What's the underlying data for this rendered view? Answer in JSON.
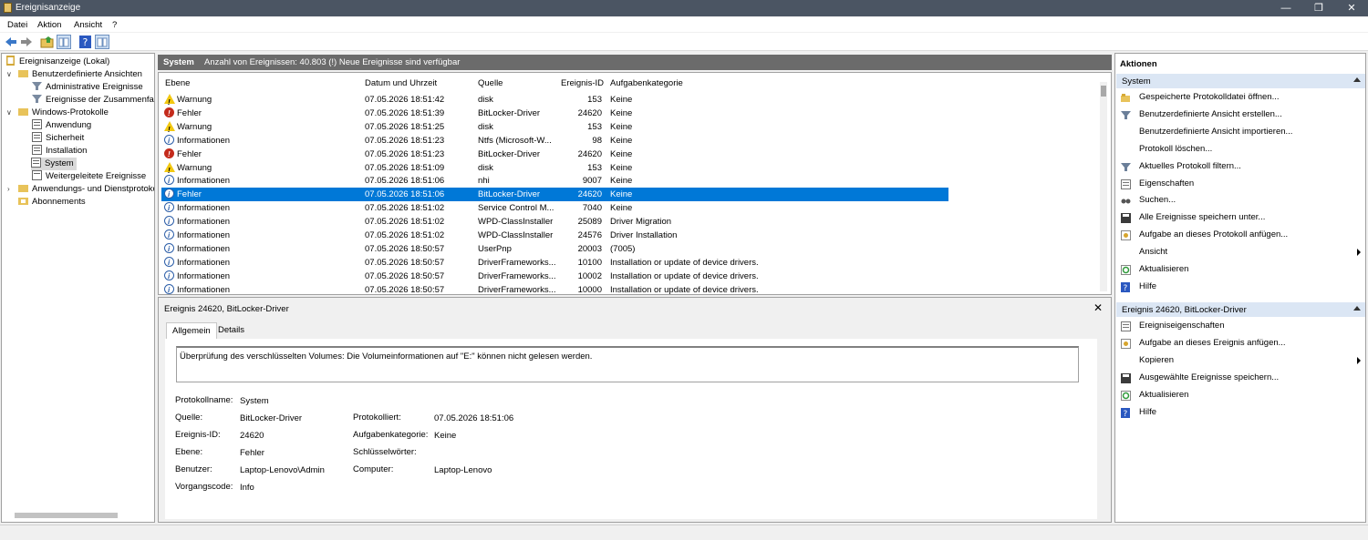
{
  "window": {
    "title": "Ereignisanzeige"
  },
  "menu": [
    "Datei",
    "Aktion",
    "Ansicht",
    "?"
  ],
  "tree": {
    "root": "Ereignisanzeige (Lokal)",
    "custom_views": "Benutzerdefinierte Ansichten",
    "admin_events": "Administrative Ereignisse",
    "summary_events": "Ereignisse der Zusammenfass",
    "windows_logs": "Windows-Protokolle",
    "application": "Anwendung",
    "security": "Sicherheit",
    "installation": "Installation",
    "system": "System",
    "forwarded": "Weitergeleitete Ereignisse",
    "app_service_logs": "Anwendungs- und Dienstprotoko",
    "subscriptions": "Abonnements"
  },
  "log_header": {
    "name": "System",
    "count": "Anzahl von Ereignissen: 40.803 (!) Neue Ereignisse sind verfügbar"
  },
  "columns": {
    "level": "Ebene",
    "datetime": "Datum und Uhrzeit",
    "source": "Quelle",
    "event_id": "Ereignis-ID",
    "category": "Aufgabenkategorie"
  },
  "events": [
    {
      "icon": "warn",
      "level": "Warnung",
      "datetime": "07.05.2026 18:51:42",
      "source": "disk",
      "id": "153",
      "category": "Keine"
    },
    {
      "icon": "err",
      "level": "Fehler",
      "datetime": "07.05.2026 18:51:39",
      "source": "BitLocker-Driver",
      "id": "24620",
      "category": "Keine"
    },
    {
      "icon": "warn",
      "level": "Warnung",
      "datetime": "07.05.2026 18:51:25",
      "source": "disk",
      "id": "153",
      "category": "Keine"
    },
    {
      "icon": "info",
      "level": "Informationen",
      "datetime": "07.05.2026 18:51:23",
      "source": "Ntfs (Microsoft-W...",
      "id": "98",
      "category": "Keine"
    },
    {
      "icon": "err",
      "level": "Fehler",
      "datetime": "07.05.2026 18:51:23",
      "source": "BitLocker-Driver",
      "id": "24620",
      "category": "Keine"
    },
    {
      "icon": "warn",
      "level": "Warnung",
      "datetime": "07.05.2026 18:51:09",
      "source": "disk",
      "id": "153",
      "category": "Keine"
    },
    {
      "icon": "info",
      "level": "Informationen",
      "datetime": "07.05.2026 18:51:06",
      "source": "nhi",
      "id": "9007",
      "category": "Keine"
    },
    {
      "icon": "info",
      "level": "Fehler",
      "datetime": "07.05.2026 18:51:06",
      "source": "BitLocker-Driver",
      "id": "24620",
      "category": "Keine",
      "selected": true
    },
    {
      "icon": "info",
      "level": "Informationen",
      "datetime": "07.05.2026 18:51:02",
      "source": "Service Control M...",
      "id": "7040",
      "category": "Keine"
    },
    {
      "icon": "info",
      "level": "Informationen",
      "datetime": "07.05.2026 18:51:02",
      "source": "WPD-ClassInstaller",
      "id": "25089",
      "category": "Driver Migration"
    },
    {
      "icon": "info",
      "level": "Informationen",
      "datetime": "07.05.2026 18:51:02",
      "source": "WPD-ClassInstaller",
      "id": "24576",
      "category": "Driver Installation"
    },
    {
      "icon": "info",
      "level": "Informationen",
      "datetime": "07.05.2026 18:50:57",
      "source": "UserPnp",
      "id": "20003",
      "category": "(7005)"
    },
    {
      "icon": "info",
      "level": "Informationen",
      "datetime": "07.05.2026 18:50:57",
      "source": "DriverFrameworks...",
      "id": "10100",
      "category": "Installation or update of device drivers."
    },
    {
      "icon": "info",
      "level": "Informationen",
      "datetime": "07.05.2026 18:50:57",
      "source": "DriverFrameworks...",
      "id": "10002",
      "category": "Installation or update of device drivers."
    },
    {
      "icon": "info",
      "level": "Informationen",
      "datetime": "07.05.2026 18:50:57",
      "source": "DriverFrameworks...",
      "id": "10000",
      "category": "Installation or update of device drivers."
    }
  ],
  "detail": {
    "title": "Ereignis 24620, BitLocker-Driver",
    "tab_general": "Allgemein",
    "tab_details": "Details",
    "message": "Überprüfung des verschlüsselten Volumes: Die Volumeinformationen auf \"E:\" können nicht gelesen werden.",
    "labels": {
      "log_name": "Protokollname:",
      "source": "Quelle:",
      "event_id": "Ereignis-ID:",
      "level": "Ebene:",
      "user": "Benutzer:",
      "opcode": "Vorgangscode:",
      "logged": "Protokolliert:",
      "task_category": "Aufgabenkategorie:",
      "keywords": "Schlüsselwörter:",
      "computer": "Computer:"
    },
    "values": {
      "log_name": "System",
      "source": "BitLocker-Driver",
      "event_id": "24620",
      "level": "Fehler",
      "user": "Laptop-Lenovo\\Admin",
      "opcode": "Info",
      "logged": "07.05.2026 18:51:06",
      "task_category": "Keine",
      "keywords": "",
      "computer": "Laptop-Lenovo"
    }
  },
  "actions": {
    "title": "Aktionen",
    "section_system": "System",
    "system_items": [
      "Gespeicherte Protokolldatei öffnen...",
      "Benutzerdefinierte Ansicht erstellen...",
      "Benutzerdefinierte Ansicht importieren...",
      "Protokoll löschen...",
      "Aktuelles Protokoll filtern...",
      "Eigenschaften",
      "Suchen...",
      "Alle Ereignisse speichern unter...",
      "Aufgabe an dieses Protokoll anfügen...",
      "Ansicht",
      "Aktualisieren",
      "Hilfe"
    ],
    "section_event": "Ereignis 24620, BitLocker-Driver",
    "event_items": [
      "Ereigniseigenschaften",
      "Aufgabe an dieses Ereignis anfügen...",
      "Kopieren",
      "Ausgewählte Ereignisse speichern...",
      "Aktualisieren",
      "Hilfe"
    ]
  }
}
